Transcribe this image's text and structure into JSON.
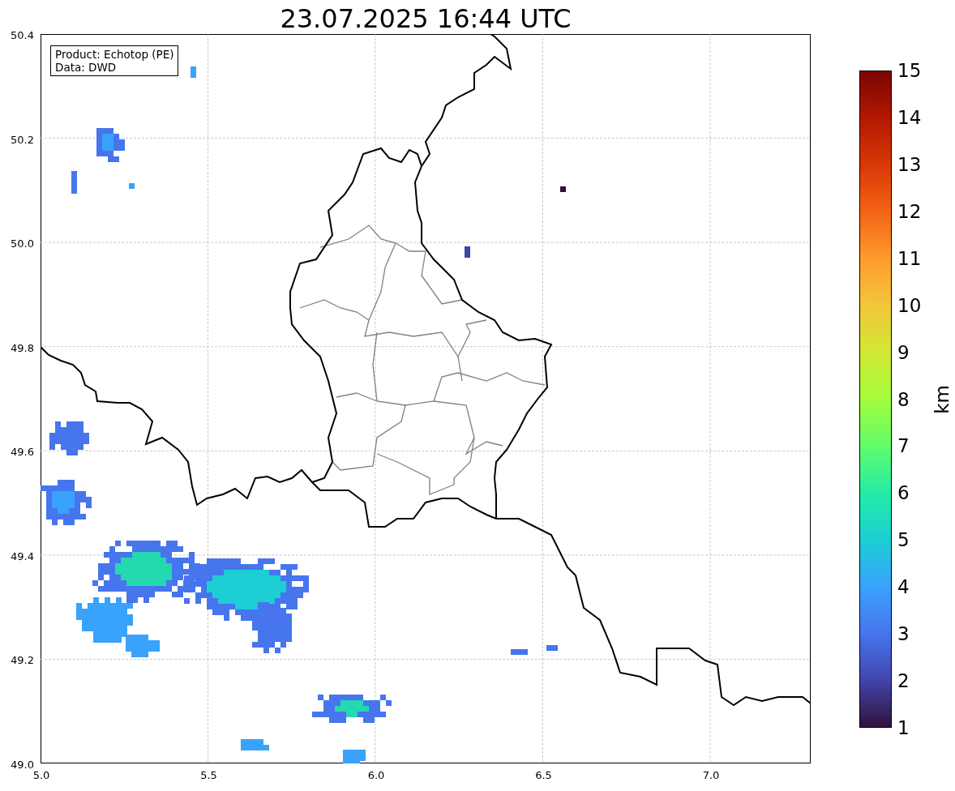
{
  "title": "23.07.2025 16:44 UTC",
  "map": {
    "info_lines": [
      "Product: Echotop (PE)",
      "Data: DWD"
    ],
    "xticks": [
      "5.0",
      "5.5",
      "6.0",
      "6.5",
      "7.0"
    ],
    "yticks": [
      "50.4",
      "50.2",
      "50.0",
      "49.8",
      "49.6",
      "49.4",
      "49.2",
      "49.0"
    ]
  },
  "colorbar": {
    "label": "km",
    "ticks": [
      "15",
      "14",
      "13",
      "12",
      "11",
      "10",
      "9",
      "8",
      "7",
      "6",
      "5",
      "4",
      "3",
      "2",
      "1"
    ]
  }
}
